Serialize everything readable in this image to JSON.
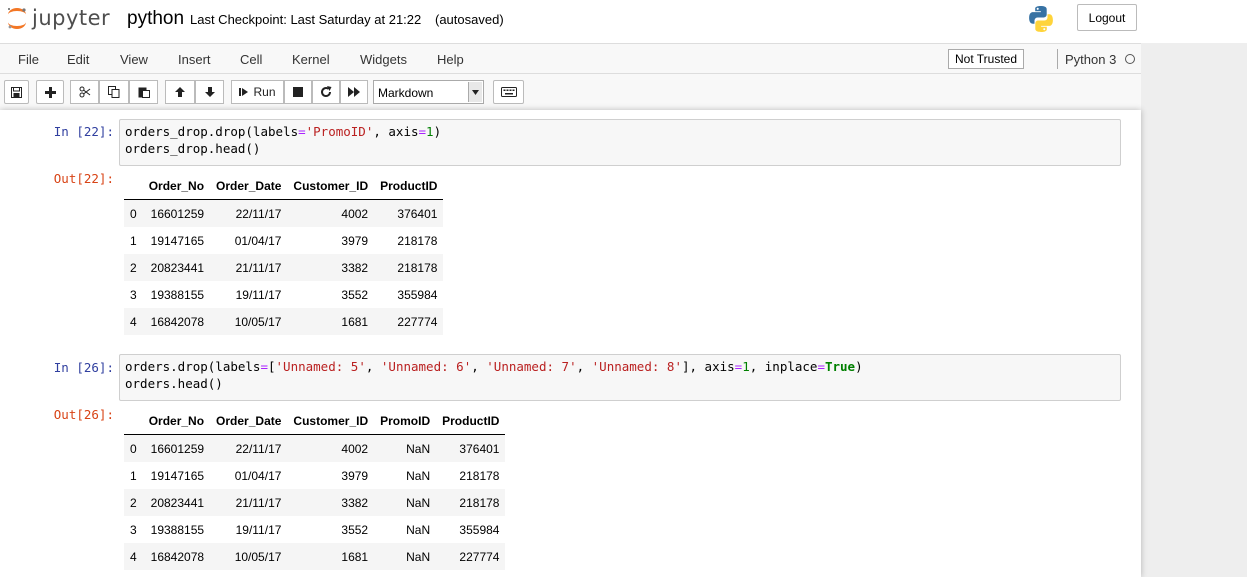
{
  "header": {
    "logo_text": "jupyter",
    "notebook_name": "python",
    "checkpoint": "Last Checkpoint: Last Saturday at 21:22",
    "autosave": "(autosaved)",
    "logout_label": "Logout"
  },
  "menu": [
    "File",
    "Edit",
    "View",
    "Insert",
    "Cell",
    "Kernel",
    "Widgets",
    "Help"
  ],
  "trust_label": "Not Trusted",
  "kernel_name": "Python 3",
  "toolbar": {
    "run_label": "Run",
    "cell_type": "Markdown",
    "buttons": [
      "save-icon",
      "plus-icon",
      "scissors-icon",
      "copy-icon",
      "paste-icon",
      "arrow-up-icon",
      "arrow-down-icon",
      "step-forward-icon",
      "stop-icon",
      "refresh-icon",
      "fast-forward-icon",
      "keyboard-icon"
    ]
  },
  "cells": [
    {
      "in_prompt": "In [22]:",
      "out_prompt": "Out[22]:",
      "code_lines": [
        "orders_drop.drop(labels='PromoID', axis=1)",
        "orders_drop.head()"
      ],
      "table": {
        "columns": [
          "Order_No",
          "Order_Date",
          "Customer_ID",
          "ProductID"
        ],
        "rows": [
          {
            "index": "0",
            "values": [
              "16601259",
              "22/11/17",
              "4002",
              "376401"
            ]
          },
          {
            "index": "1",
            "values": [
              "19147165",
              "01/04/17",
              "3979",
              "218178"
            ]
          },
          {
            "index": "2",
            "values": [
              "20823441",
              "21/11/17",
              "3382",
              "218178"
            ]
          },
          {
            "index": "3",
            "values": [
              "19388155",
              "19/11/17",
              "3552",
              "355984"
            ]
          },
          {
            "index": "4",
            "values": [
              "16842078",
              "10/05/17",
              "1681",
              "227774"
            ]
          }
        ]
      }
    },
    {
      "in_prompt": "In [26]:",
      "out_prompt": "Out[26]:",
      "code_lines": [
        "orders.drop(labels=['Unnamed: 5', 'Unnamed: 6', 'Unnamed: 7', 'Unnamed: 8'], axis=1, inplace=True)",
        "orders.head()"
      ],
      "table": {
        "columns": [
          "Order_No",
          "Order_Date",
          "Customer_ID",
          "PromoID",
          "ProductID"
        ],
        "rows": [
          {
            "index": "0",
            "values": [
              "16601259",
              "22/11/17",
              "4002",
              "NaN",
              "376401"
            ]
          },
          {
            "index": "1",
            "values": [
              "19147165",
              "01/04/17",
              "3979",
              "NaN",
              "218178"
            ]
          },
          {
            "index": "2",
            "values": [
              "20823441",
              "21/11/17",
              "3382",
              "NaN",
              "218178"
            ]
          },
          {
            "index": "3",
            "values": [
              "19388155",
              "19/11/17",
              "3552",
              "NaN",
              "355984"
            ]
          },
          {
            "index": "4",
            "values": [
              "16842078",
              "10/05/17",
              "1681",
              "NaN",
              "227774"
            ]
          }
        ]
      }
    }
  ]
}
